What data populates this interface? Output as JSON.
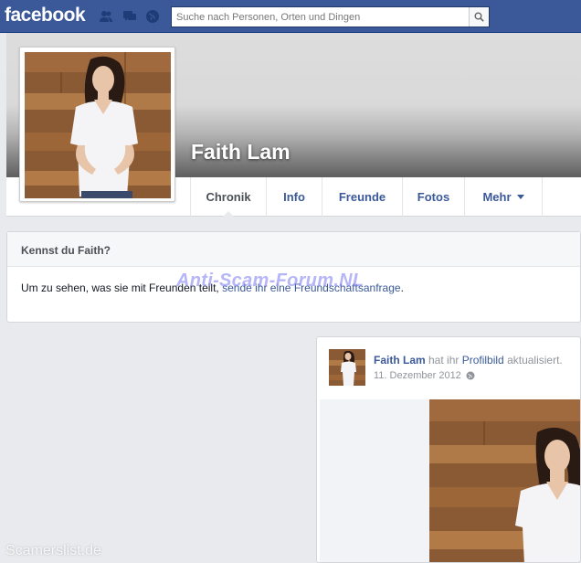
{
  "topbar": {
    "logo": "facebook",
    "search_placeholder": "Suche nach Personen, Orten und Dingen",
    "icons": [
      "friends-icon",
      "messages-icon",
      "notifications-globe-icon",
      "search-icon"
    ]
  },
  "profile": {
    "name": "Faith Lam",
    "tabs": [
      "Chronik",
      "Info",
      "Freunde",
      "Fotos",
      "Mehr"
    ]
  },
  "know": {
    "title": "Kennst du Faith?",
    "text_before": "Um zu sehen, was sie mit Freunden teilt, ",
    "link": "sende ihr eine Freundschaftsanfrage",
    "text_after": "."
  },
  "story": {
    "name": "Faith Lam",
    "action": " hat ihr ",
    "object": "Profilbild",
    "action_end": " aktualisiert.",
    "date": "11. Dezember 2012",
    "privacy_icon": "globe-icon"
  },
  "watermarks": {
    "center": "Anti-Scam-Forum.NL",
    "bottom": "Scamerslist.de"
  },
  "colors": {
    "brand": "#3b5998",
    "link": "#3b5998",
    "background": "#e9eaed"
  }
}
